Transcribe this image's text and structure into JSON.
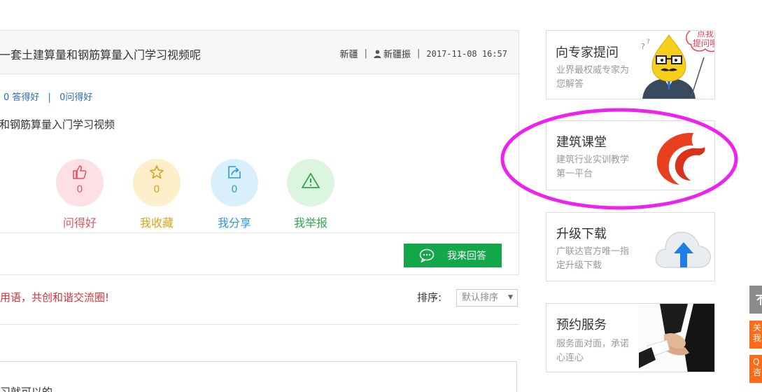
{
  "question": {
    "title": "一套土建算量和钢筋算量入门学习视频呢",
    "region": "新疆",
    "author": "新疆振",
    "time": "2017-11-08 16:57",
    "stats_answers": "0 答得好",
    "stats_asks": "0问得好",
    "description": "和钢筋算量入门学习视频"
  },
  "actions": [
    {
      "count": "0",
      "label": "问得好",
      "color": "#e05563",
      "bg": "#fde0e3",
      "icon": "thumbs-up-icon"
    },
    {
      "count": "0",
      "label": "我收藏",
      "color": "#d9a21a",
      "bg": "#fdefc9",
      "icon": "star-icon"
    },
    {
      "count": "0",
      "label": "我分享",
      "color": "#2a9ad8",
      "bg": "#d9f0fc",
      "icon": "share-icon"
    },
    {
      "count": "0",
      "label": "我举报",
      "color": "#36a453",
      "bg": "#dcf5df",
      "icon": "warning-icon"
    }
  ],
  "answer_button": "我来回答",
  "notice": "用语，共创和谐交流圈!",
  "sort": {
    "label": "排序:",
    "selected": "默认排序"
  },
  "answer_preview": "习就可以的",
  "sidebar": [
    {
      "title": "向专家提问",
      "desc": "业界最权威专家为您解答",
      "bubble": "点我\n提问哦"
    },
    {
      "title": "建筑课堂",
      "desc": "建筑行业实训教学第一平台"
    },
    {
      "title": "升级下载",
      "desc": "广联达官方唯一指定升级下载"
    },
    {
      "title": "预约服务",
      "desc": "服务面对面，承诺心连心"
    }
  ],
  "right_tabs": {
    "tab1": "关我",
    "tab2": "Q咨"
  },
  "colors": {
    "accent_green": "#12a84a",
    "highlight_magenta": "#ee22ee",
    "link_blue": "#2a6fb5",
    "notice_red": "#d0353b"
  }
}
